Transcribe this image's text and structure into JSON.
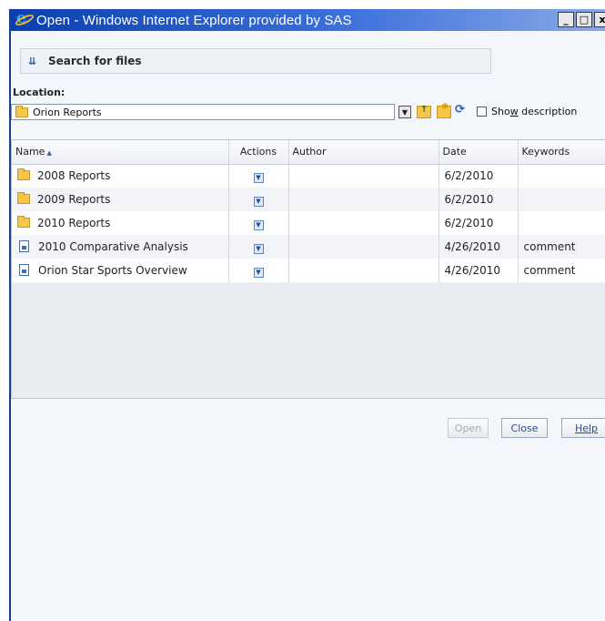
{
  "window": {
    "title": "Open - Windows Internet Explorer provided by SAS",
    "minimize": "_",
    "maximize": "□",
    "close": "x"
  },
  "search": {
    "label": "Search for files"
  },
  "location": {
    "label": "Location:",
    "value": "Orion Reports",
    "show_description_pre": "Sho",
    "show_description_key": "w",
    "show_description_post": " description"
  },
  "table": {
    "columns": [
      "Name",
      "Actions",
      "Author",
      "Date",
      "Keywords"
    ],
    "rows": [
      {
        "type": "folder",
        "name": "2008 Reports",
        "author": "",
        "date": "6/2/2010",
        "keywords": ""
      },
      {
        "type": "folder",
        "name": "2009 Reports",
        "author": "",
        "date": "6/2/2010",
        "keywords": ""
      },
      {
        "type": "folder",
        "name": "2010 Reports",
        "author": "",
        "date": "6/2/2010",
        "keywords": ""
      },
      {
        "type": "report",
        "name": "2010 Comparative Analysis",
        "author": "",
        "date": "4/26/2010",
        "keywords": "comment"
      },
      {
        "type": "report",
        "name": "Orion Star Sports Overview",
        "author": "",
        "date": "4/26/2010",
        "keywords": "comment"
      }
    ]
  },
  "buttons": {
    "open": "Open",
    "close": "Close",
    "help": "Help"
  },
  "icons": {
    "app": "internet-explorer-icon",
    "folder": "folder-icon",
    "report": "report-icon",
    "actions": "dropdown-arrow-icon",
    "up": "up-folder-icon",
    "new": "new-folder-icon",
    "refresh": "refresh-icon"
  }
}
